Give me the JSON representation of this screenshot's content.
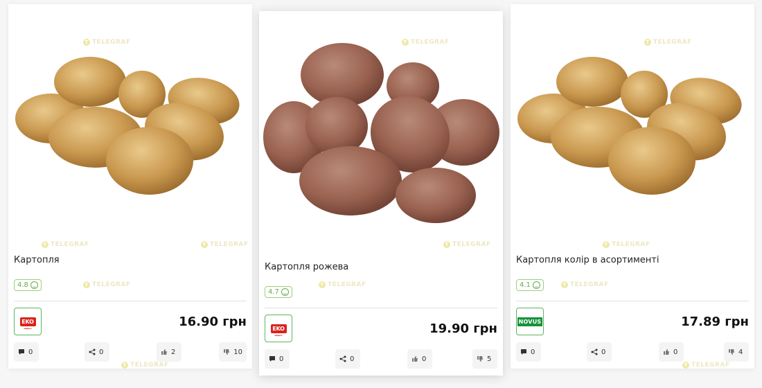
{
  "watermark": "TELEGRAF",
  "products": [
    {
      "title": "Картопля",
      "rating": "4.8",
      "store": "EKO",
      "store_sub": "маркет",
      "price": "16.90 грн",
      "image_icon": "yellow-potatoes-photo",
      "comments": "0",
      "shares": "0",
      "likes": "2",
      "dislikes": "10"
    },
    {
      "title": "Картопля рожева",
      "rating": "4.7",
      "store": "EKO",
      "store_sub": "маркет",
      "price": "19.90 грн",
      "image_icon": "red-potatoes-photo",
      "comments": "0",
      "shares": "0",
      "likes": "0",
      "dislikes": "5"
    },
    {
      "title": "Картопля колір в асортименті",
      "rating": "4.1",
      "store": "NOVUS",
      "price": "17.89 грн",
      "image_icon": "yellow-potatoes-photo",
      "comments": "0",
      "shares": "0",
      "likes": "0",
      "dislikes": "4"
    }
  ],
  "colors": {
    "accent_green": "#5ab55f",
    "eko_red": "#d9241c",
    "novus_green": "#15943b"
  }
}
